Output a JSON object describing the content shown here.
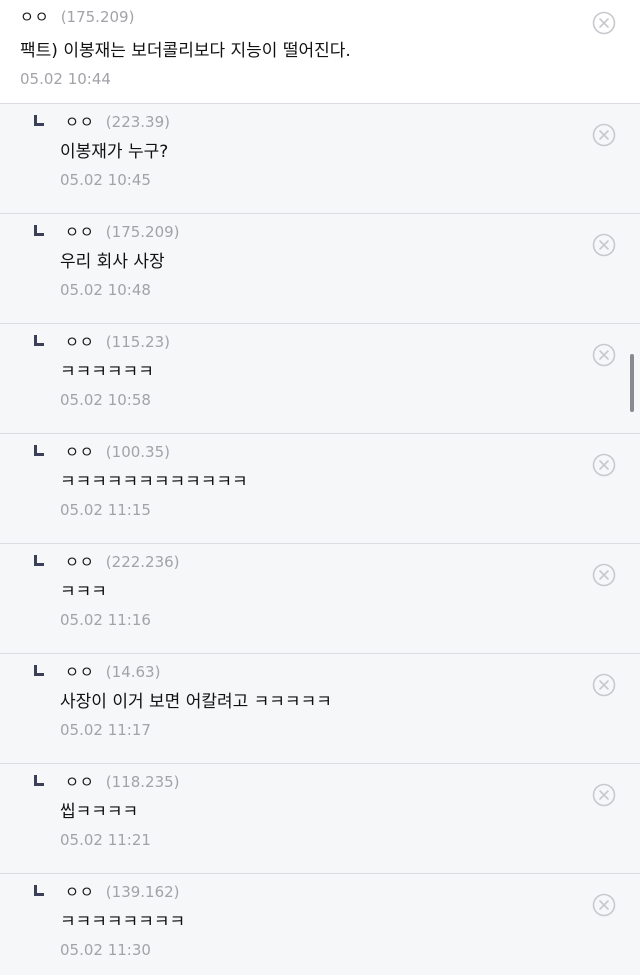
{
  "comment": {
    "nick": "ㅇㅇ",
    "ip": "(175.209)",
    "text": "팩트) 이봉재는 보더콜리보다 지능이 떨어진다.",
    "time": "05.02 10:44"
  },
  "replies": [
    {
      "nick": "ㅇㅇ",
      "ip": "(223.39)",
      "text": "이봉재가 누구?",
      "time": "05.02 10:45"
    },
    {
      "nick": "ㅇㅇ",
      "ip": "(175.209)",
      "text": "우리 회사 사장",
      "time": "05.02 10:48"
    },
    {
      "nick": "ㅇㅇ",
      "ip": "(115.23)",
      "text": "ㅋㅋㅋㅋㅋㅋ",
      "time": "05.02 10:58"
    },
    {
      "nick": "ㅇㅇ",
      "ip": "(100.35)",
      "text": "ㅋㅋㅋㅋㅋㅋㅋㅋㅋㅋㅋㅋ",
      "time": "05.02 11:15"
    },
    {
      "nick": "ㅇㅇ",
      "ip": "(222.236)",
      "text": "ㅋㅋㅋ",
      "time": "05.02 11:16"
    },
    {
      "nick": "ㅇㅇ",
      "ip": "(14.63)",
      "text": "사장이 이거 보면 어칼려고 ㅋㅋㅋㅋㅋ",
      "time": "05.02 11:17"
    },
    {
      "nick": "ㅇㅇ",
      "ip": "(118.235)",
      "text": "씹ㅋㅋㅋㅋ",
      "time": "05.02 11:21"
    },
    {
      "nick": "ㅇㅇ",
      "ip": "(139.162)",
      "text": "ㅋㅋㅋㅋㅋㅋㅋㅋ",
      "time": "05.02 11:30"
    }
  ],
  "icons": {
    "delete": "circle-x-icon",
    "reply": "reply-arrow-icon"
  },
  "colors": {
    "reply_bg": "#f6f7f9",
    "meta_gray": "#a2a3a8",
    "reply_mark": "#3b3f58"
  }
}
